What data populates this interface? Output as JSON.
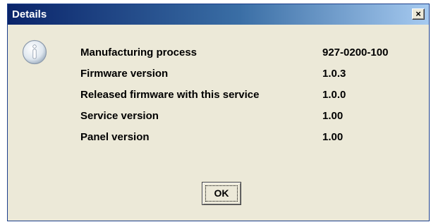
{
  "window": {
    "title": "Details",
    "close_symbol": "×",
    "title_gradient": [
      "#0a246a",
      "#3a6ea5",
      "#a6caf0"
    ],
    "background": "#ece9d8"
  },
  "icon": {
    "name": "info-icon",
    "glyph": "i"
  },
  "details": [
    {
      "label": "Manufacturing process",
      "value": "927-0200-100"
    },
    {
      "label": "Firmware version",
      "value": "1.0.3"
    },
    {
      "label": "Released firmware with this service",
      "value": "1.0.0"
    },
    {
      "label": "Service version",
      "value": "1.00"
    },
    {
      "label": "Panel version",
      "value": "1.00"
    }
  ],
  "buttons": {
    "ok_label": "OK"
  }
}
